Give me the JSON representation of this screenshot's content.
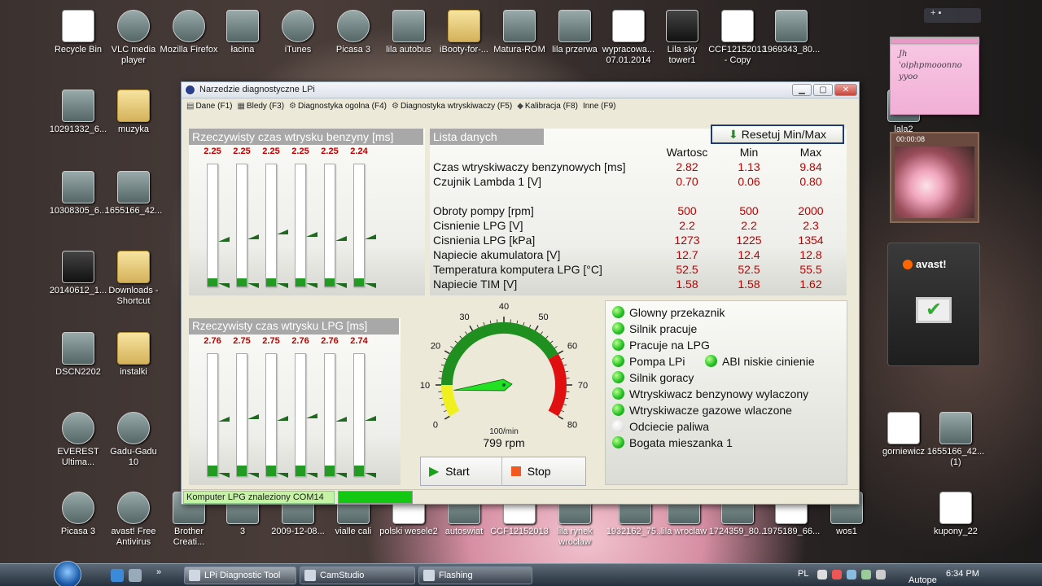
{
  "desktop": {
    "icons": [
      {
        "label": "Recycle Bin",
        "kind": "doc"
      },
      {
        "label": "VLC media player",
        "kind": "round"
      },
      {
        "label": "Mozilla Firefox",
        "kind": "round"
      },
      {
        "label": "łacina",
        "kind": "plain"
      },
      {
        "label": "iTunes",
        "kind": "round"
      },
      {
        "label": "Picasa 3",
        "kind": "round"
      },
      {
        "label": "lila autobus",
        "kind": "plain"
      },
      {
        "label": "iBooty-for-...",
        "kind": "folder"
      },
      {
        "label": "Matura-ROM",
        "kind": "plain"
      },
      {
        "label": "lila przerwa",
        "kind": "plain"
      },
      {
        "label": "wypracowa... 07.01.2014",
        "kind": "doc"
      },
      {
        "label": "Lila sky tower1",
        "kind": "dark"
      },
      {
        "label": "CCF12152013 - Copy",
        "kind": "doc"
      },
      {
        "label": "1969343_80...",
        "kind": "plain"
      },
      {
        "label": "10291332_6...",
        "kind": "plain"
      },
      {
        "label": "muzyka",
        "kind": "folder"
      },
      {
        "label": "10308305_6...",
        "kind": "plain"
      },
      {
        "label": "1655166_42...",
        "kind": "plain"
      },
      {
        "label": "20140612_1...",
        "kind": "dark"
      },
      {
        "label": "Downloads - Shortcut",
        "kind": "folder"
      },
      {
        "label": "DSCN2202",
        "kind": "plain"
      },
      {
        "label": "instalki",
        "kind": "folder"
      },
      {
        "label": "EVEREST Ultima...",
        "kind": "round"
      },
      {
        "label": "Gadu-Gadu 10",
        "kind": "round"
      },
      {
        "label": "Picasa 3",
        "kind": "round"
      },
      {
        "label": "avast! Free Antivirus",
        "kind": "round"
      },
      {
        "label": "Brother Creati...",
        "kind": "plain"
      },
      {
        "label": "3",
        "kind": "plain"
      },
      {
        "label": "2009-12-08...",
        "kind": "plain"
      },
      {
        "label": "vialle cali",
        "kind": "plain"
      },
      {
        "label": "polski wesele2",
        "kind": "doc"
      },
      {
        "label": "autoswiat",
        "kind": "plain"
      },
      {
        "label": "CCF12152013",
        "kind": "doc"
      },
      {
        "label": "lila rynek wrocław",
        "kind": "plain"
      },
      {
        "label": "1932162_75...",
        "kind": "plain"
      },
      {
        "label": "lila wroclaw",
        "kind": "plain"
      },
      {
        "label": "1724359_80...",
        "kind": "plain"
      },
      {
        "label": "1975189_66...",
        "kind": "doc"
      },
      {
        "label": "wos1",
        "kind": "plain"
      },
      {
        "label": "kupony_22",
        "kind": "doc"
      },
      {
        "label": "gorniewicz",
        "kind": "doc"
      },
      {
        "label": "1655166_42... (1)",
        "kind": "plain"
      },
      {
        "label": "lala2",
        "kind": "plain"
      }
    ],
    "sticky_note": "Jh 'oiphpmooonno yyoo",
    "puzzle_timer": "00:00:08",
    "avast_label": "avast!"
  },
  "window": {
    "title": "Narzedzie diagnostyczne LPi",
    "tabs": [
      {
        "label": "Dane (F1)",
        "icon": "disk-icon"
      },
      {
        "label": "Bledy (F3)",
        "icon": "error-icon"
      },
      {
        "label": "Diagnostyka ogolna (F4)",
        "icon": "gears-icon"
      },
      {
        "label": "Diagnostyka wtryskiwaczy (F5)",
        "icon": "gears-icon"
      },
      {
        "label": "Kalibracja (F8)",
        "icon": "calibration-icon"
      },
      {
        "label": "Inne (F9)",
        "icon": ""
      }
    ],
    "reset_button": "Resetuj Min/Max",
    "petrol_panel": {
      "title": "Rzeczywisty czas wtrysku benzyny [ms]",
      "values": [
        "2.25",
        "2.25",
        "2.25",
        "2.25",
        "2.25",
        "2.24"
      ],
      "fill_fraction": [
        0.07,
        0.07,
        0.07,
        0.07,
        0.07,
        0.07
      ],
      "marker_fraction": [
        0.36,
        0.38,
        0.42,
        0.4,
        0.37,
        0.38
      ]
    },
    "lpg_panel": {
      "title": "Rzeczywisty czas wtrysku LPG [ms]",
      "values": [
        "2.76",
        "2.75",
        "2.75",
        "2.76",
        "2.76",
        "2.74"
      ],
      "fill_fraction": [
        0.09,
        0.09,
        0.09,
        0.09,
        0.09,
        0.09
      ],
      "marker_fraction": [
        0.44,
        0.46,
        0.45,
        0.47,
        0.44,
        0.45
      ]
    },
    "data_list": {
      "title": "Lista danych",
      "headers": [
        "Wartosc",
        "Min",
        "Max"
      ],
      "rows": [
        {
          "name": "Czas wtryskiwaczy benzynowych [ms]",
          "value": "2.82",
          "min": "1.13",
          "max": "9.84"
        },
        {
          "name": "Czujnik Lambda 1 [V]",
          "value": "0.70",
          "min": "0.06",
          "max": "0.80"
        },
        {
          "name": "",
          "value": "",
          "min": "",
          "max": ""
        },
        {
          "name": "Obroty pompy [rpm]",
          "value": "500",
          "min": "500",
          "max": "2000"
        },
        {
          "name": "Cisnienie LPG [V]",
          "value": "2.2",
          "min": "2.2",
          "max": "2.3"
        },
        {
          "name": "Cisnienia LPG [kPa]",
          "value": "1273",
          "min": "1225",
          "max": "1354"
        },
        {
          "name": "Napiecie akumulatora [V]",
          "value": "12.7",
          "min": "12.4",
          "max": "12.8"
        },
        {
          "name": "Temperatura komputera LPG [°C]",
          "value": "52.5",
          "min": "52.5",
          "max": "55.5"
        },
        {
          "name": "Napiecie TIM [V]",
          "value": "1.58",
          "min": "1.58",
          "max": "1.62"
        }
      ]
    },
    "gauge": {
      "ticks": [
        "0",
        "10",
        "20",
        "30",
        "40",
        "50",
        "60",
        "70",
        "80"
      ],
      "unit": "100/min",
      "readout": "799 rpm",
      "value": 7.99,
      "max": 80
    },
    "controls": {
      "start": "Start",
      "stop": "Stop"
    },
    "status_items": [
      {
        "label": "Glowny przekaznik",
        "on": true
      },
      {
        "label": "Silnik pracuje",
        "on": true
      },
      {
        "label": "Pracuje na LPG",
        "on": true
      },
      {
        "label": "Pompa LPi",
        "on": true
      },
      {
        "label": "ABI niskie cinienie",
        "on": true
      },
      {
        "label": "Silnik goracy",
        "on": true
      },
      {
        "label": "Wtryskiwacz benzynowy wylaczony",
        "on": true
      },
      {
        "label": "Wtryskiwacze gazowe wlaczone",
        "on": true
      },
      {
        "label": "Odciecie paliwa",
        "on": false
      },
      {
        "label": "Bogata mieszanka 1",
        "on": true
      }
    ],
    "statusbar": {
      "text": "Komputer LPG znaleziony COM14",
      "progress": 1.0
    }
  },
  "taskbar": {
    "buttons": [
      "LPi Diagnostic Tool",
      "CamStudio",
      "Flashing"
    ],
    "language": "PL",
    "clock": "6:34 PM",
    "overflow": "Autope"
  },
  "colors": {
    "value_red": "#c00000",
    "led_green": "#28c428",
    "gauge_green": "#1f8f1f",
    "gauge_red": "#e01010",
    "gauge_yellow": "#f0f020"
  }
}
